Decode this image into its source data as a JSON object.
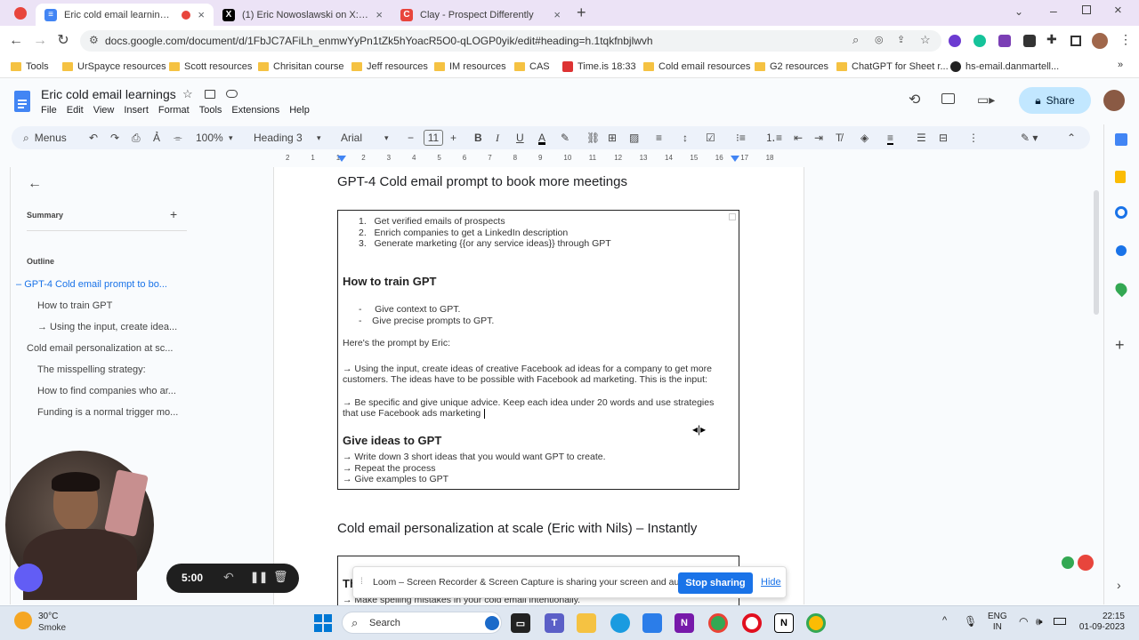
{
  "browser": {
    "tabs": [
      {
        "title": "Eric cold email learnings - Go",
        "fav": "#4285f4",
        "glyph": "≡"
      },
      {
        "title": "(1) Eric Nowoslawski on X: \"AND",
        "fav": "#000000",
        "glyph": "X"
      },
      {
        "title": "Clay - Prospect Differently",
        "fav": "#e8453c",
        "glyph": "C"
      }
    ],
    "url": "docs.google.com/document/d/1FbJC7AFiLh_enmwYyPn1tZk5hYoacR5O0-qLOGP0yik/edit#heading=h.1tqkfnbjlwvh",
    "bookmarks": [
      "Tools",
      "UrSpayce resources",
      "Scott resources",
      "Chrisitan course",
      "Jeff resources",
      "IM resources",
      "CAS",
      "Time.is 18:33",
      "Cold email resources",
      "G2 resources",
      "ChatGPT for Sheet r...",
      "hs-email.danmartell..."
    ]
  },
  "docs": {
    "title": "Eric cold email learnings",
    "menu": [
      "File",
      "Edit",
      "View",
      "Insert",
      "Format",
      "Tools",
      "Extensions",
      "Help"
    ],
    "share_label": "Share",
    "toolbar": {
      "menus": "Menus",
      "zoom": "100%",
      "style": "Heading 3",
      "font": "Arial",
      "size": "11"
    },
    "ruler_numbers": [
      "2",
      "1",
      "1",
      "2",
      "3",
      "4",
      "5",
      "6",
      "7",
      "8",
      "9",
      "10",
      "11",
      "12",
      "13",
      "14",
      "15",
      "16",
      "17",
      "18"
    ]
  },
  "left_panel": {
    "summary_label": "Summary",
    "outline_label": "Outline",
    "items": [
      {
        "text": "GPT-4 Cold email prompt to bo...",
        "level": 1,
        "active": true
      },
      {
        "text": "How to train GPT",
        "level": 2
      },
      {
        "text": "→ Using the input, create idea...",
        "level": 2
      },
      {
        "text": "Cold email personalization at sc...",
        "level": 1
      },
      {
        "text": "The misspelling strategy:",
        "level": 2
      },
      {
        "text": "How to find companies who ar...",
        "level": 2
      },
      {
        "text": "Funding is a normal trigger mo...",
        "level": 2
      }
    ]
  },
  "document": {
    "heading1": "GPT-4 Cold email prompt to book more meetings",
    "list1": [
      "Get verified emails of prospects",
      "Enrich companies to get a LinkedIn description",
      "Generate marketing {{or any service ideas}} through GPT"
    ],
    "heading_train": "How to train GPT",
    "list2": [
      "Give context to GPT.",
      "Give precise prompts to GPT."
    ],
    "prompt_intro": "Here's the prompt by Eric:",
    "para1_line1": "→ Using the input, create ideas of creative Facebook ad ideas for a company to get more",
    "para1_line2": "customers. The ideas have to be possible with Facebook ad marketing. This is the input:",
    "para2_line1": "→ Be specific and give unique advice. Keep each idea under 20 words and use strategies",
    "para2_line2": "that use Facebook ads marketing",
    "heading_give": "Give ideas to GPT",
    "give_lines": [
      "→ Write down 3 short ideas that you would want GPT to create.",
      "→ Repeat the process",
      "→ Give examples to GPT"
    ],
    "heading2": "Cold email personalization at scale (Eric with Nils) – Instantly",
    "box2_heading": "Th",
    "box2_line": "→ Make spelling mistakes in your cold email intentionally."
  },
  "recorder": {
    "time": "5:00"
  },
  "loom": {
    "message": "Loom – Screen Recorder & Screen Capture is sharing your screen and audio.",
    "stop_label": "Stop sharing",
    "hide_label": "Hide"
  },
  "taskbar": {
    "weather_temp": "30°C",
    "weather_desc": "Smoke",
    "search_label": "Search",
    "lang1": "ENG",
    "lang2": "IN",
    "time": "22:15",
    "date": "01-09-2023"
  }
}
